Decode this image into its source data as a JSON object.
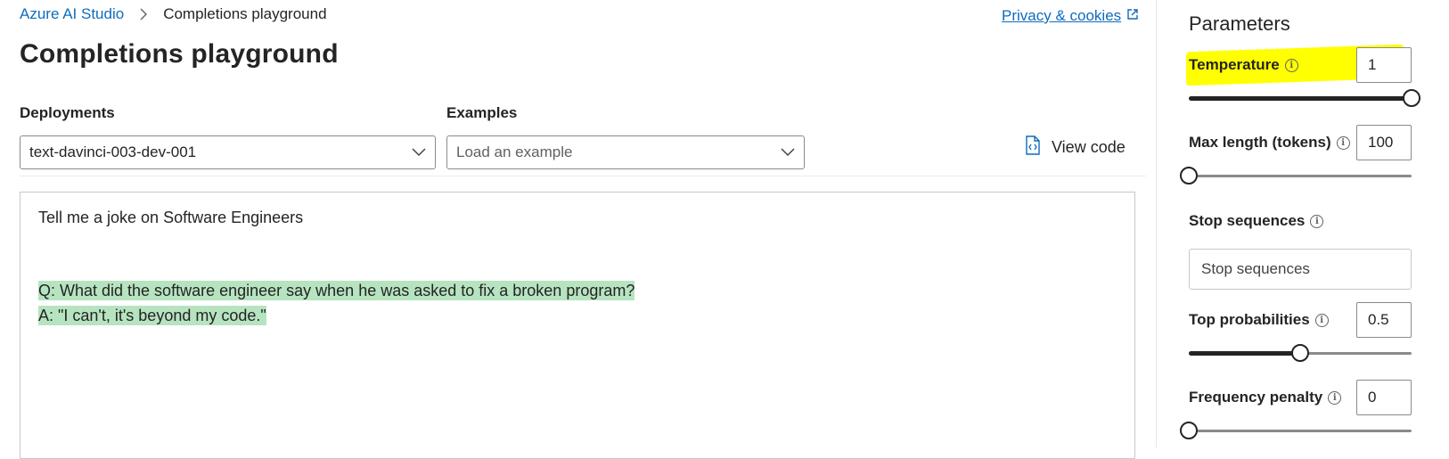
{
  "breadcrumb": {
    "root": "Azure AI Studio",
    "current": "Completions playground"
  },
  "privacy": {
    "label": "Privacy & cookies"
  },
  "page": {
    "title": "Completions playground"
  },
  "deployments": {
    "label": "Deployments",
    "value": "text-davinci-003-dev-001"
  },
  "examples": {
    "label": "Examples",
    "placeholder": "Load an example"
  },
  "view_code": {
    "label": "View code"
  },
  "editor": {
    "prompt": "Tell me a joke on Software Engineers",
    "completion": [
      "Q: What did the software engineer say when he was asked to fix a broken program?",
      "A: \"I can't, it's beyond my code.\""
    ],
    "highlight_color": "#b7e4c0"
  },
  "parameters": {
    "title": "Parameters",
    "temperature": {
      "label": "Temperature",
      "value": "1",
      "level": 1.0
    },
    "max_length": {
      "label": "Max length (tokens)",
      "value": "100",
      "level": 0.0
    },
    "stop_sequences": {
      "label": "Stop sequences",
      "placeholder": "Stop sequences"
    },
    "top_p": {
      "label": "Top probabilities",
      "value": "0.5",
      "level": 0.5
    },
    "frequency_penalty": {
      "label": "Frequency penalty",
      "value": "0",
      "level": 0.0
    }
  },
  "colors": {
    "link": "#0f6cbd",
    "annotation_highlight": "#ffff00"
  },
  "icons": [
    "chevron-right-icon",
    "open-external-icon",
    "chevron-down-icon",
    "code-file-icon",
    "info-icon"
  ]
}
